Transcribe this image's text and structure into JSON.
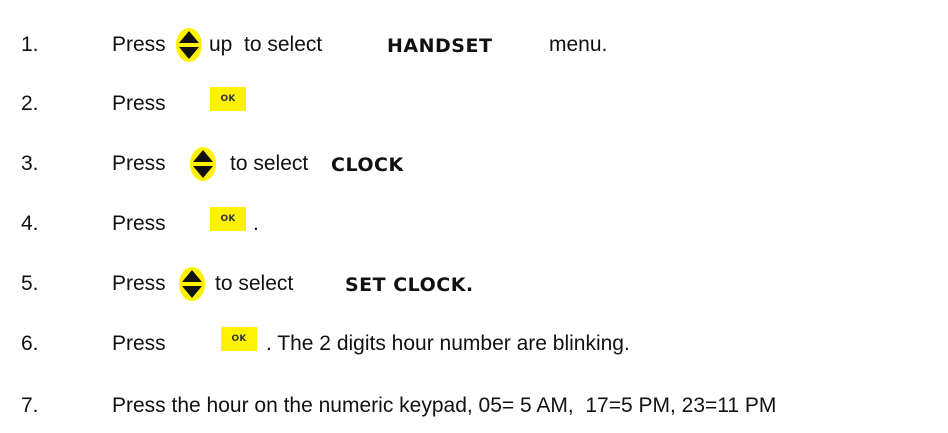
{
  "steps": [
    {
      "number": "1.",
      "press": "Press",
      "after": "up  to select",
      "bold": "HANDSET",
      "tail": "menu."
    },
    {
      "number": "2.",
      "press": "Press"
    },
    {
      "number": "3.",
      "press": "Press",
      "after": "to select",
      "bold": "CLOCK",
      "tail": "."
    },
    {
      "number": "4.",
      "press": "Press",
      "tail": "."
    },
    {
      "number": "5.",
      "press": "Press",
      "after": "to select",
      "bold": "SET CLOCK."
    },
    {
      "number": "6.",
      "press": "Press",
      "tail": ". The 2 digits hour number are blinking."
    },
    {
      "number": "7.",
      "text": "Press the hour on the numeric keypad, 05= 5 AM,  17=5 PM, 23=11 PM"
    }
  ],
  "icons": {
    "ok_label": "OK",
    "ok_color": "#fff200",
    "nav_color": "#fff200",
    "arrow_color": "#111111"
  }
}
